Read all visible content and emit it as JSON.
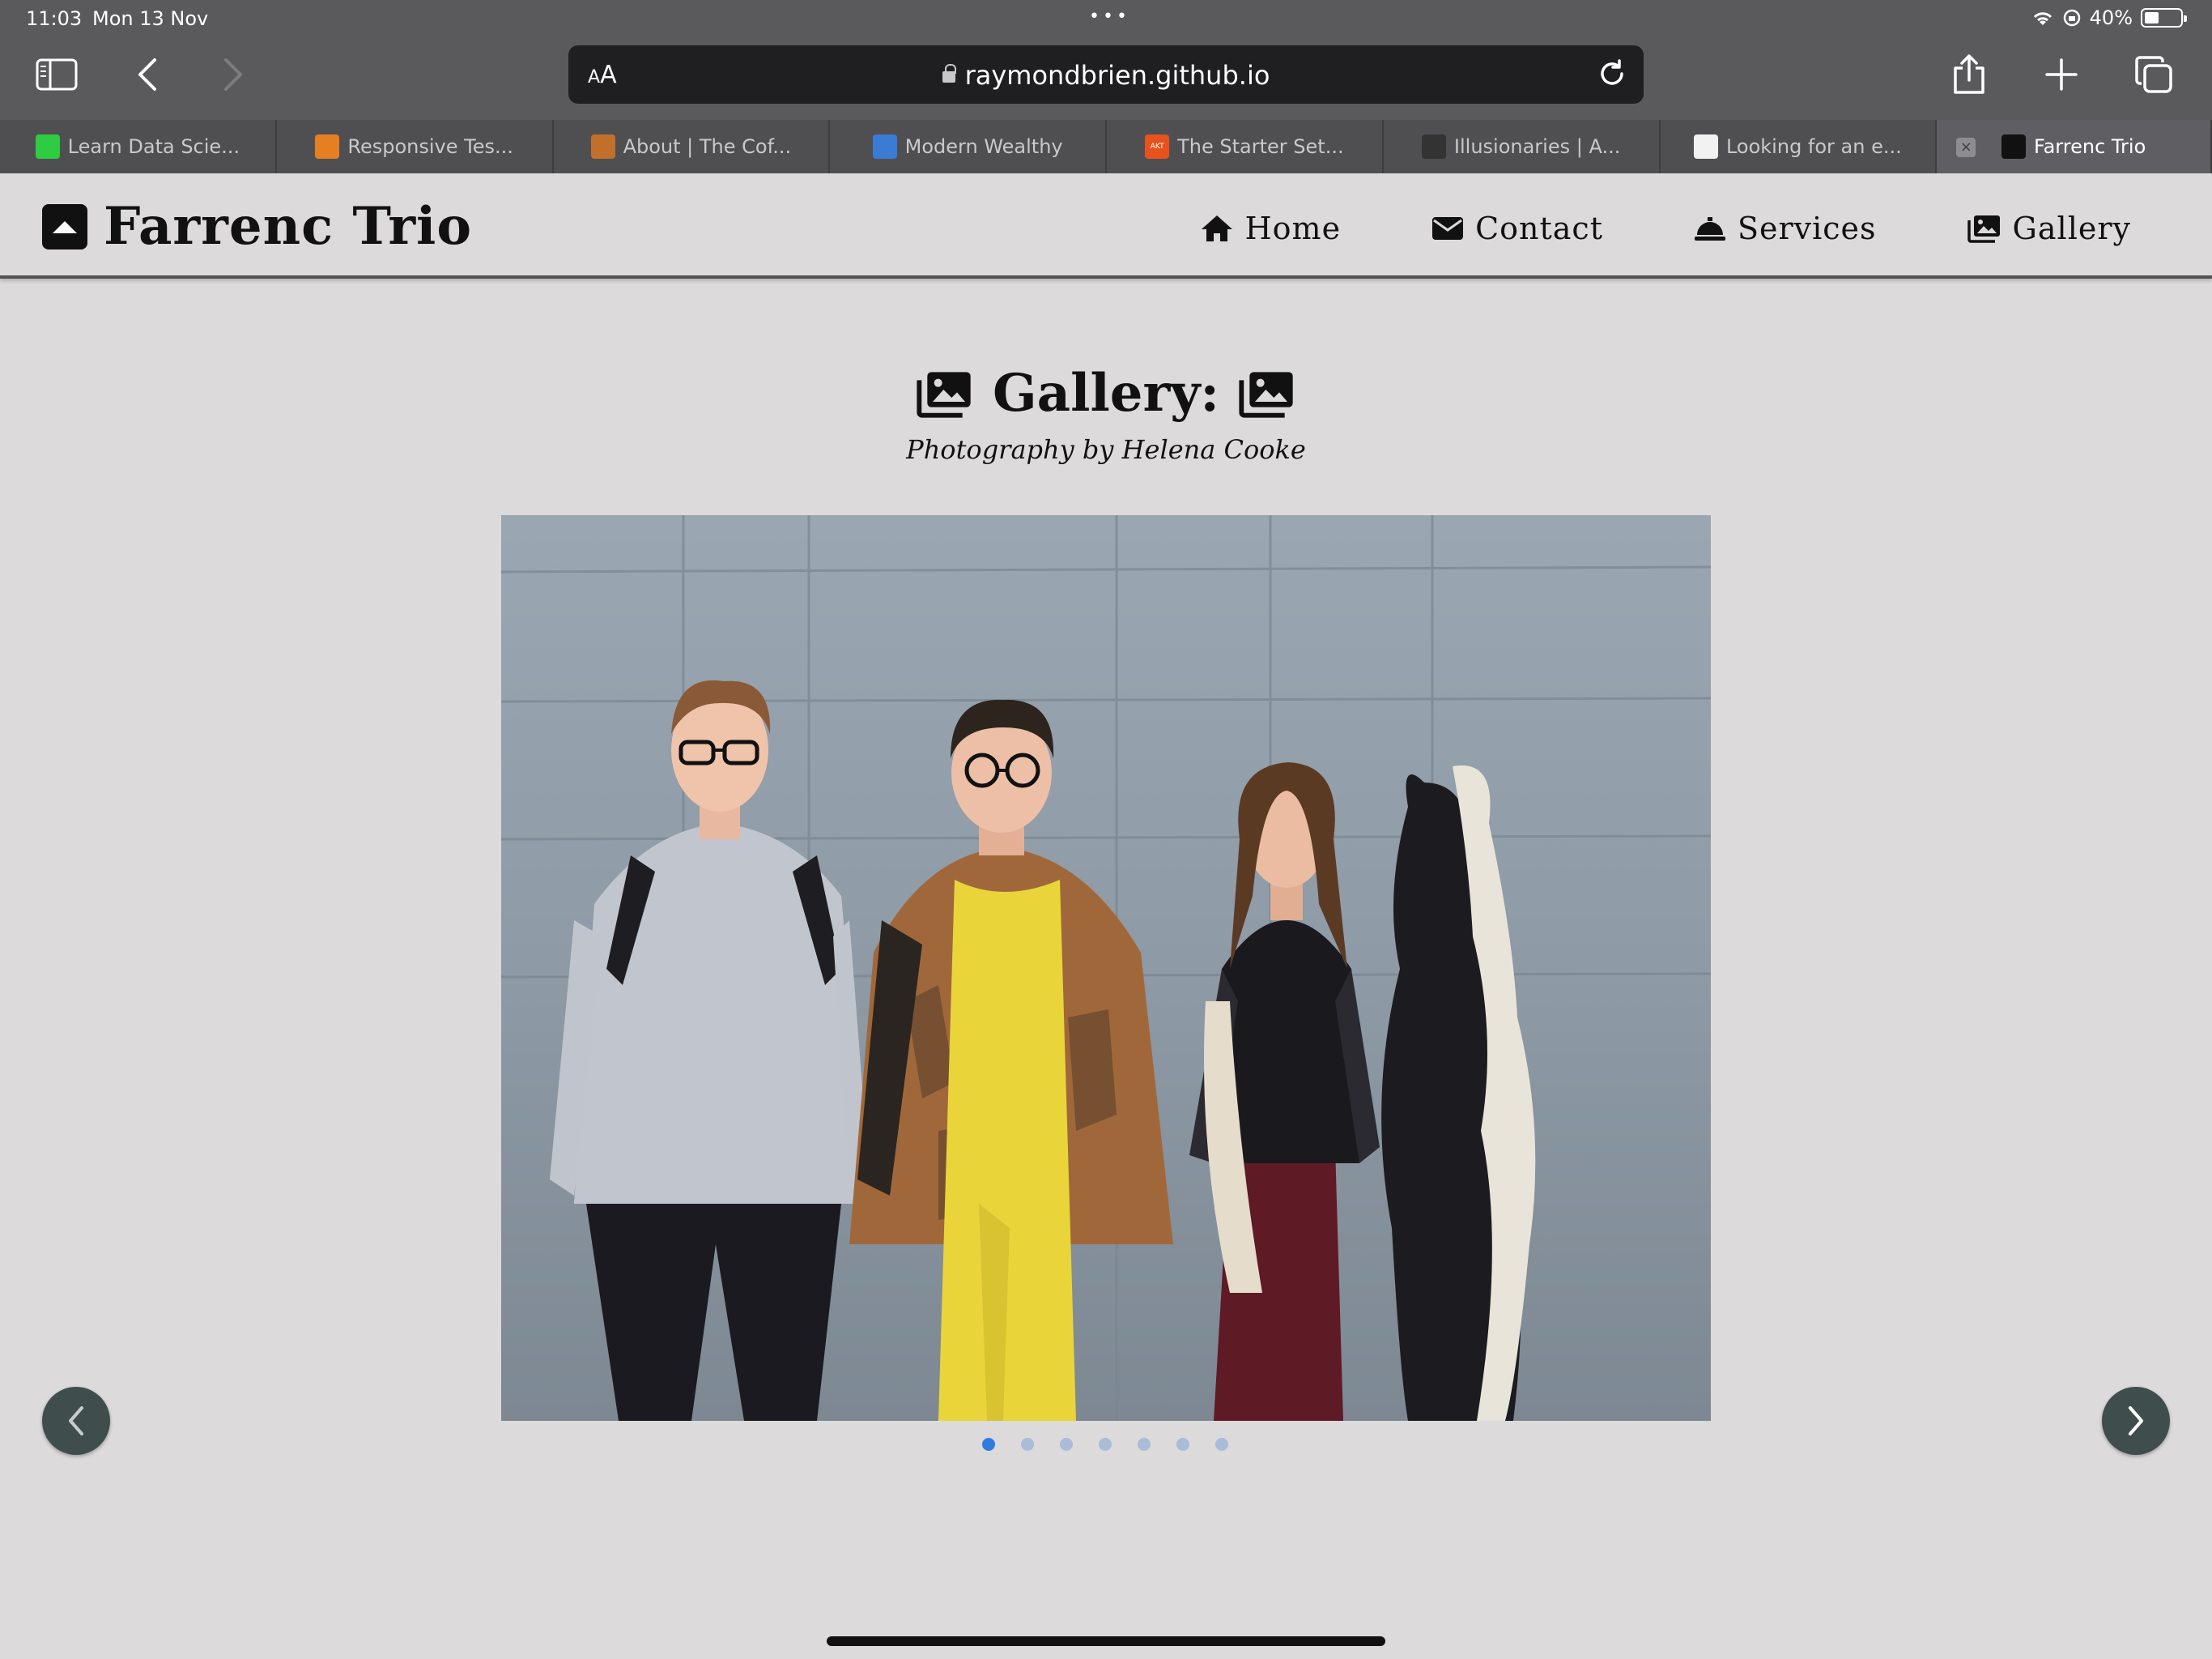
{
  "status": {
    "time": "11:03",
    "date": "Mon 13 Nov",
    "battery": "40%",
    "battery_level": 0.4
  },
  "browser": {
    "aa_label": "AA",
    "url": "raymondbrien.github.io",
    "tabs": [
      {
        "title": "Learn Data Scie...",
        "favicon_color": "#2ecc40"
      },
      {
        "title": "Responsive Tes...",
        "favicon_color": "#e67e22"
      },
      {
        "title": "About | The Cof...",
        "favicon_color": "#c0702a"
      },
      {
        "title": "Modern Wealthy",
        "favicon_color": "#3a7bd5"
      },
      {
        "title": "The Starter Set...",
        "favicon_color": "#e8521c",
        "favicon_text": "AKT"
      },
      {
        "title": "Illusionaries | A...",
        "favicon_color": "#333333"
      },
      {
        "title": "Looking for an e...",
        "favicon_color": "#f2f2f2"
      },
      {
        "title": "Farrenc Trio",
        "favicon_color": "#111111",
        "active": true
      }
    ]
  },
  "site": {
    "brand": "Farrenc Trio",
    "nav": [
      {
        "label": "Home",
        "icon": "home-icon"
      },
      {
        "label": "Contact",
        "icon": "envelope-icon"
      },
      {
        "label": "Services",
        "icon": "bell-icon"
      },
      {
        "label": "Gallery",
        "icon": "images-icon"
      }
    ]
  },
  "gallery": {
    "title": "Gallery:",
    "subtitle": "Photography by Helena Cooke",
    "slide_count": 7,
    "active_slide": 1
  },
  "colors": {
    "accent": "#2f7be0",
    "arrow_bg": "#3f4e4c",
    "page_bg": "#dcdadb"
  }
}
